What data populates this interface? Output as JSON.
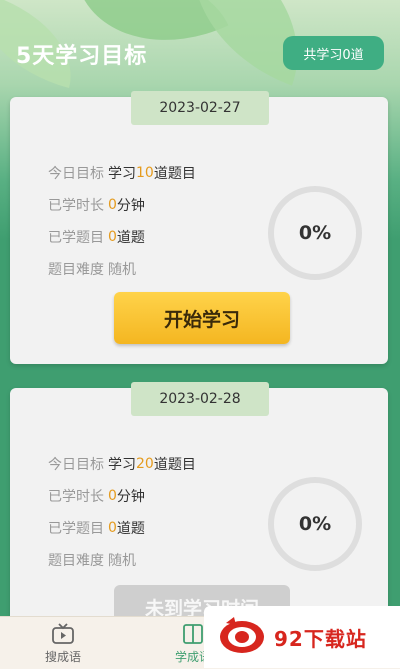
{
  "header": {
    "title": "5天学习目标",
    "total_badge": "共学习0道"
  },
  "days": [
    {
      "date": "2023-02-27",
      "goal_label": "今日目标",
      "goal_prefix": "学习",
      "goal_count": "10",
      "goal_suffix": "道题目",
      "time_label": "已学时长",
      "time_value": "0",
      "time_unit": "分钟",
      "done_label": "已学题目",
      "done_value": "0",
      "done_unit": "道题",
      "difficulty_label": "题目难度",
      "difficulty_value": "随机",
      "progress": "0%",
      "button_label": "开始学习"
    },
    {
      "date": "2023-02-28",
      "goal_label": "今日目标",
      "goal_prefix": "学习",
      "goal_count": "20",
      "goal_suffix": "道题目",
      "time_label": "已学时长",
      "time_value": "0",
      "time_unit": "分钟",
      "done_label": "已学题目",
      "done_value": "0",
      "done_unit": "道题",
      "difficulty_label": "题目难度",
      "difficulty_value": "随机",
      "progress": "0%",
      "button_label": "未到学习时间"
    }
  ],
  "tabbar": {
    "items": [
      {
        "label": "搜成语",
        "icon": "tv-icon"
      },
      {
        "label": "学成语",
        "icon": "book-icon"
      }
    ]
  },
  "watermark": {
    "text": "92下载站"
  },
  "colors": {
    "accent": "#3f9e70",
    "highlight": "#e59b1e",
    "button": "#f4b621"
  }
}
